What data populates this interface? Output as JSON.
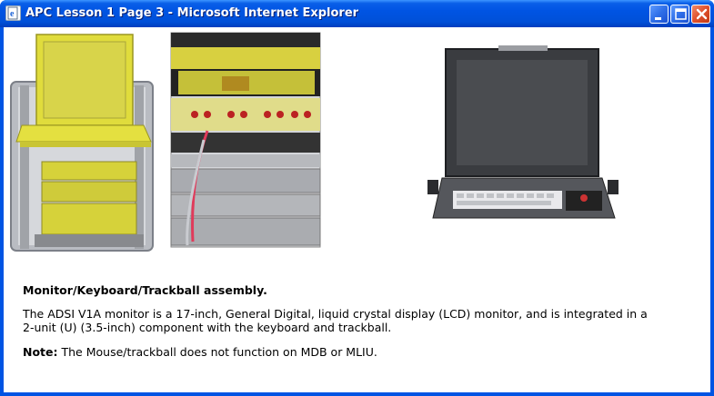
{
  "window": {
    "title": "APC Lesson 1 Page 3 - Microsoft Internet Explorer",
    "icon": "ie-page-icon",
    "controls": [
      "minimize-icon",
      "maximize-icon",
      "close-icon"
    ]
  },
  "content": {
    "heading": "Monitor/Keyboard/Trackball assembly.",
    "paragraph": "The ADSI V1A monitor is a 17-inch, General Digital, liquid crystal display (LCD) monitor, and is integrated in a 2-unit (U) (3.5-inch) component with the keyboard and trackball.",
    "note_label": "Note:",
    "note_text": " The Mouse/trackball does not function on MDB or MLIU."
  },
  "colors": {
    "titlebar": "#0054e3",
    "highlight": "#e8e000"
  }
}
